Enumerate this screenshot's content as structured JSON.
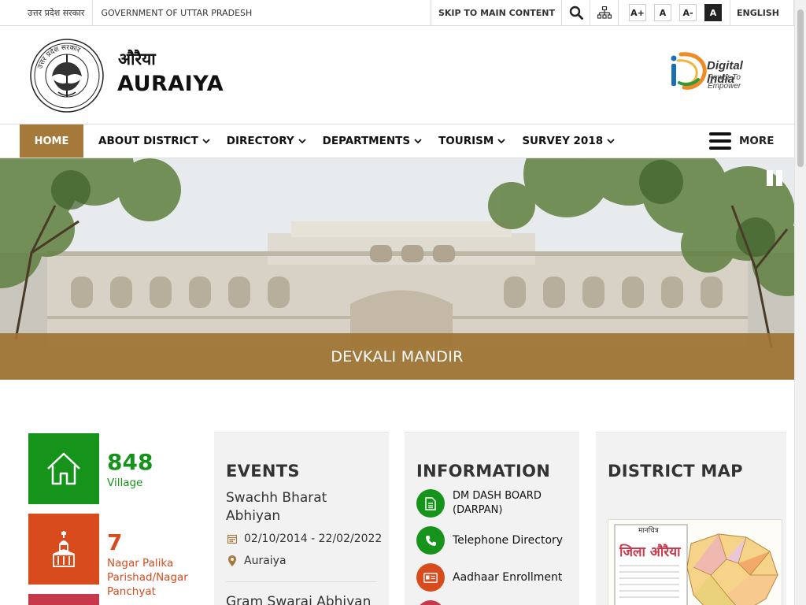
{
  "topbar": {
    "hindi_text": "उत्तर प्रदेश सरकार",
    "gov_text": "GOVERNMENT OF UTTAR PRADESH",
    "skip_label": "SKIP TO MAIN CONTENT",
    "font_increase": "A+",
    "font_normal": "A",
    "font_decrease": "A-",
    "contrast": "A",
    "language": "ENGLISH"
  },
  "header": {
    "title_hindi": "औरैया",
    "title_english": "AURAIYA",
    "emblem_text": "उत्तर प्रदेश सरकार",
    "digital_india_title": "Digital India",
    "digital_india_tagline": "Power To Empower"
  },
  "nav": {
    "home": "HOME",
    "items": [
      {
        "label": "ABOUT DISTRICT"
      },
      {
        "label": "DIRECTORY"
      },
      {
        "label": "DEPARTMENTS"
      },
      {
        "label": "TOURISM"
      },
      {
        "label": "SURVEY 2018"
      }
    ],
    "more": "MORE"
  },
  "hero": {
    "caption": "DEVKALI MANDIR"
  },
  "stats": [
    {
      "number": "848",
      "label": "Village",
      "color": "#16931a"
    },
    {
      "number": "7",
      "label": "Nagar Palika Parishad/Nagar Panchyat",
      "color": "#d84b1c"
    }
  ],
  "events": {
    "heading": "EVENTS",
    "items": [
      {
        "title": "Swachh Bharat Abhiyan",
        "dates": "02/10/2014 - 22/02/2022",
        "place": "Auraiya"
      },
      {
        "title": "Gram Swaraj Abhiyan"
      }
    ]
  },
  "information": {
    "heading": "INFORMATION",
    "items": [
      {
        "label": "DM DASH BOARD (DARPAN)",
        "color": "#16931a"
      },
      {
        "label": "Telephone Directory",
        "color": "#16931a"
      },
      {
        "label": "Aadhaar Enrollment",
        "color": "#d84b1c"
      }
    ]
  },
  "district_map": {
    "heading": "DISTRICT MAP",
    "map_title": "जिला औरैया",
    "map_label": "मानचित्र"
  },
  "colors": {
    "accent_brown": "#a5793a",
    "green": "#16931a",
    "orange_red": "#d84b1c",
    "crimson": "#c8384b"
  }
}
